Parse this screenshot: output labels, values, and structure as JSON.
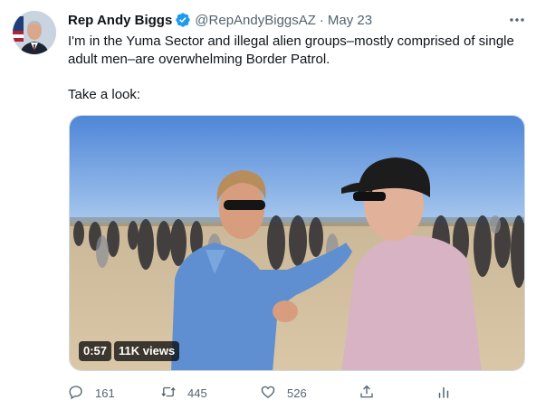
{
  "tweet": {
    "author": {
      "display_name": "Rep Andy Biggs",
      "handle": "@RepAndyBiggsAZ",
      "separator": "·",
      "date": "May 23",
      "verified": true
    },
    "text_line1": "I'm in the Yuma Sector and illegal alien groups–mostly comprised of single adult men–are overwhelming Border Patrol.",
    "text_line2": "Take a look:",
    "media": {
      "type": "video",
      "duration": "0:57",
      "views": "11K views"
    },
    "actions": {
      "reply_count": "161",
      "retweet_count": "445",
      "like_count": "526"
    },
    "icons": {
      "more": "more-icon",
      "reply": "reply-icon",
      "retweet": "retweet-icon",
      "like": "like-icon",
      "share": "share-icon",
      "analytics": "analytics-icon",
      "verified": "verified-badge-icon"
    },
    "colors": {
      "verified_blue": "#1d9bf0",
      "secondary_text": "#536471",
      "primary_text": "#0f1419"
    }
  }
}
